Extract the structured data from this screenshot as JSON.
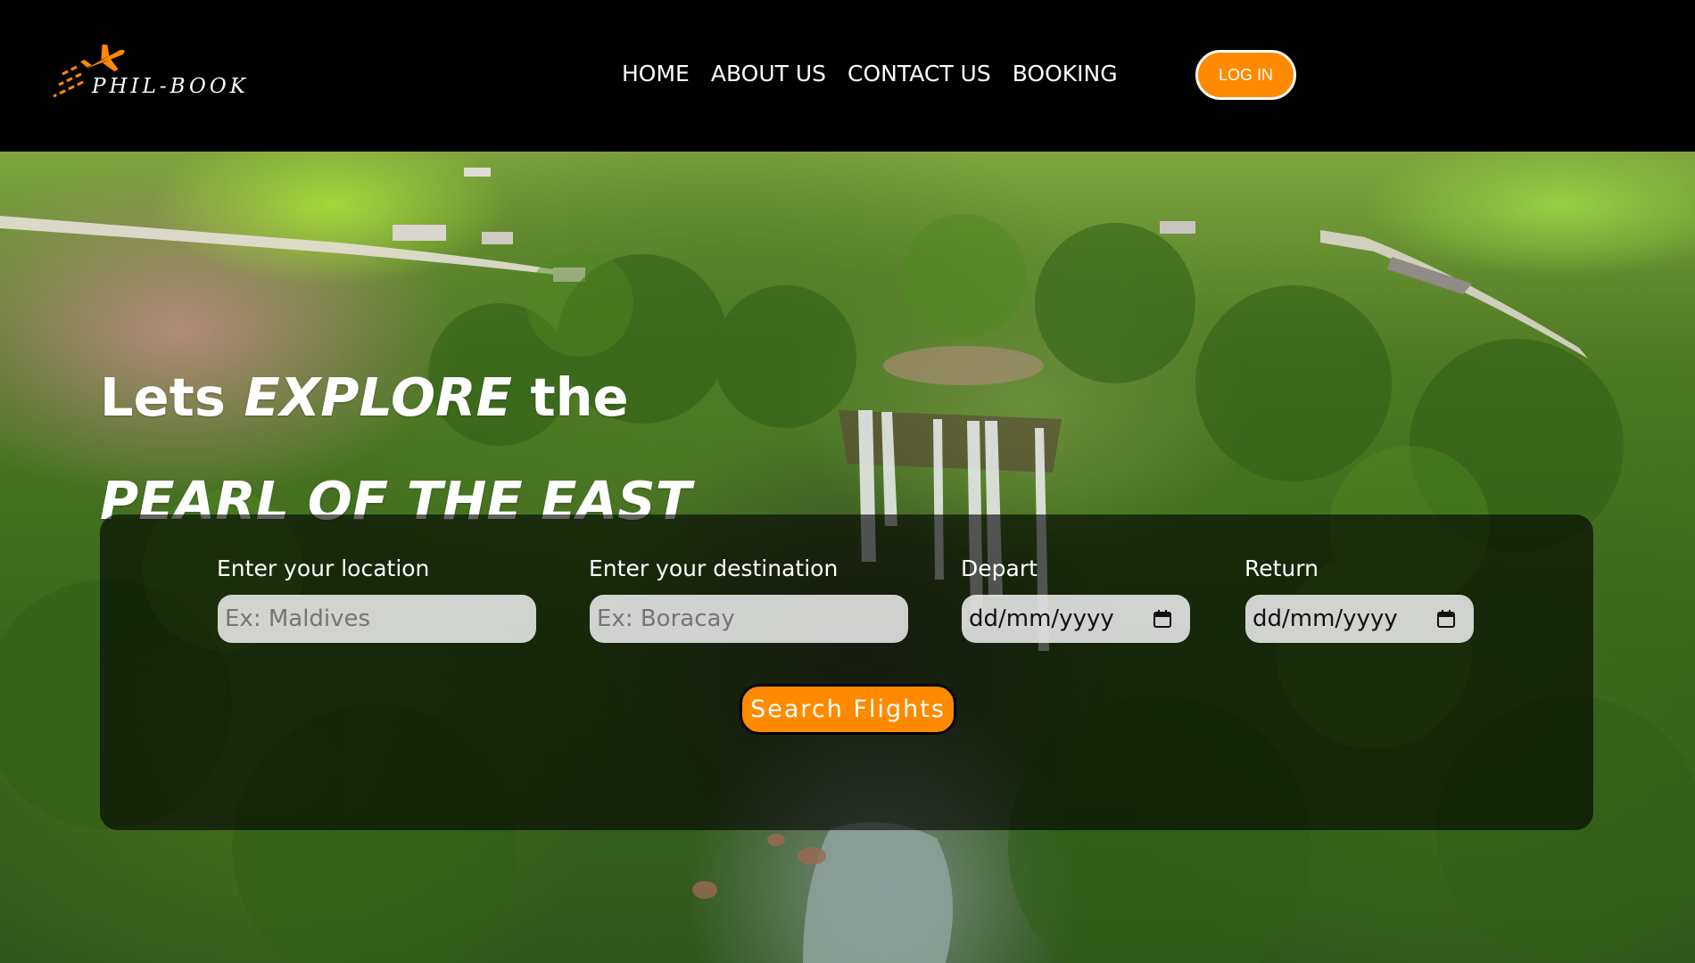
{
  "brand": {
    "name": "PHIL-BOOK",
    "logo_icon": "airplane-icon",
    "accent_color": "#ff8a00"
  },
  "nav": {
    "links": [
      {
        "label": "HOME"
      },
      {
        "label": "ABOUT US"
      },
      {
        "label": "CONTACT US"
      },
      {
        "label": "BOOKING"
      }
    ],
    "login_label": "LOG IN"
  },
  "hero": {
    "line1_prefix": "Lets",
    "line1_emphasis": "EXPLORE",
    "line1_suffix": "the",
    "line2": "PEARL OF THE EAST"
  },
  "search": {
    "location": {
      "label": "Enter your location",
      "placeholder": "Ex: Maldives"
    },
    "destination": {
      "label": "Enter your destination",
      "placeholder": "Ex: Boracay"
    },
    "depart": {
      "label": "Depart",
      "value": "dd/mm/yyyy",
      "icon": "calendar-icon"
    },
    "return": {
      "label": "Return",
      "value": "dd/mm/yyyy",
      "icon": "calendar-icon"
    },
    "button_label": "Search Flights"
  }
}
